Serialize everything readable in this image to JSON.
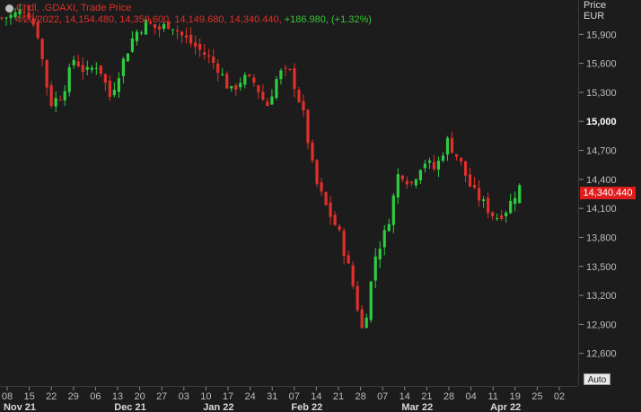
{
  "legend": {
    "series": "Cndl, .GDAXI, Trade Price",
    "ohlc": "4/20/2022, 14,154.480, 14,359.600, 14,149.680, 14,340.440,",
    "change": "+186.980, (+1.32%)"
  },
  "axis": {
    "price_label": "Price",
    "currency_label": "EUR",
    "last_price": "14,340.440",
    "auto_label": "Auto"
  },
  "colors": {
    "up": "#2ecc40",
    "down": "#e0302a",
    "background": "#1c1c1c",
    "text": "#bdbdbd"
  },
  "chart_data": {
    "type": "candlestick",
    "ylabel": "Price EUR",
    "ylim": [
      12300,
      16200
    ],
    "yticks": [
      12600,
      12900,
      13200,
      13500,
      13800,
      14100,
      14400,
      14700,
      15000,
      15300,
      15600,
      15900
    ],
    "ytick_labels": [
      "12,600",
      "12,900",
      "13,200",
      "13,500",
      "13,800",
      "14,100",
      "14,400",
      "14,700",
      "15,000",
      "15,300",
      "15,600",
      "15,900"
    ],
    "xticks": [
      "08",
      "15",
      "22",
      "29",
      "06",
      "13",
      "20",
      "27",
      "03",
      "10",
      "17",
      "24",
      "31",
      "07",
      "14",
      "21",
      "28",
      "07",
      "14",
      "21",
      "28",
      "04",
      "11",
      "19",
      "25",
      "02"
    ],
    "months": [
      {
        "label": "Nov 21",
        "tick": 0
      },
      {
        "label": "Dec 21",
        "tick": 5
      },
      {
        "label": "Jan 22",
        "tick": 9
      },
      {
        "label": "Feb 22",
        "tick": 13
      },
      {
        "label": "Mar 22",
        "tick": 18
      },
      {
        "label": "Apr 22",
        "tick": 22
      }
    ],
    "close_points": [
      [
        0,
        16070
      ],
      [
        1,
        16100
      ],
      [
        2,
        16180
      ],
      [
        3,
        15900
      ],
      [
        4,
        15180
      ],
      [
        5,
        15280
      ],
      [
        6,
        15650
      ],
      [
        7,
        15500
      ],
      [
        8,
        15600
      ],
      [
        9,
        15250
      ],
      [
        10,
        15600
      ],
      [
        11,
        15900
      ],
      [
        12,
        16020
      ],
      [
        13,
        15950
      ],
      [
        14,
        16020
      ],
      [
        15,
        15880
      ],
      [
        16,
        15780
      ],
      [
        17,
        15680
      ],
      [
        18,
        15550
      ],
      [
        19,
        15300
      ],
      [
        20,
        15450
      ],
      [
        21,
        15400
      ],
      [
        22,
        15150
      ],
      [
        23,
        15500
      ],
      [
        24,
        15500
      ],
      [
        25,
        15100
      ],
      [
        26,
        14400
      ],
      [
        27,
        14100
      ],
      [
        28,
        13850
      ],
      [
        29,
        13400
      ],
      [
        30,
        12800
      ],
      [
        31,
        13600
      ],
      [
        32,
        13900
      ],
      [
        33,
        14500
      ],
      [
        34,
        14350
      ],
      [
        35,
        14600
      ],
      [
        36,
        14500
      ],
      [
        37,
        14800
      ],
      [
        38,
        14600
      ],
      [
        39,
        14300
      ],
      [
        40,
        14150
      ],
      [
        41,
        14000
      ],
      [
        42,
        14100
      ],
      [
        43,
        14340
      ]
    ],
    "last": {
      "date": "4/20/2022",
      "open": 14154.48,
      "high": 14359.6,
      "low": 14149.68,
      "close": 14340.44,
      "change": 186.98,
      "change_pct": 1.32
    }
  }
}
